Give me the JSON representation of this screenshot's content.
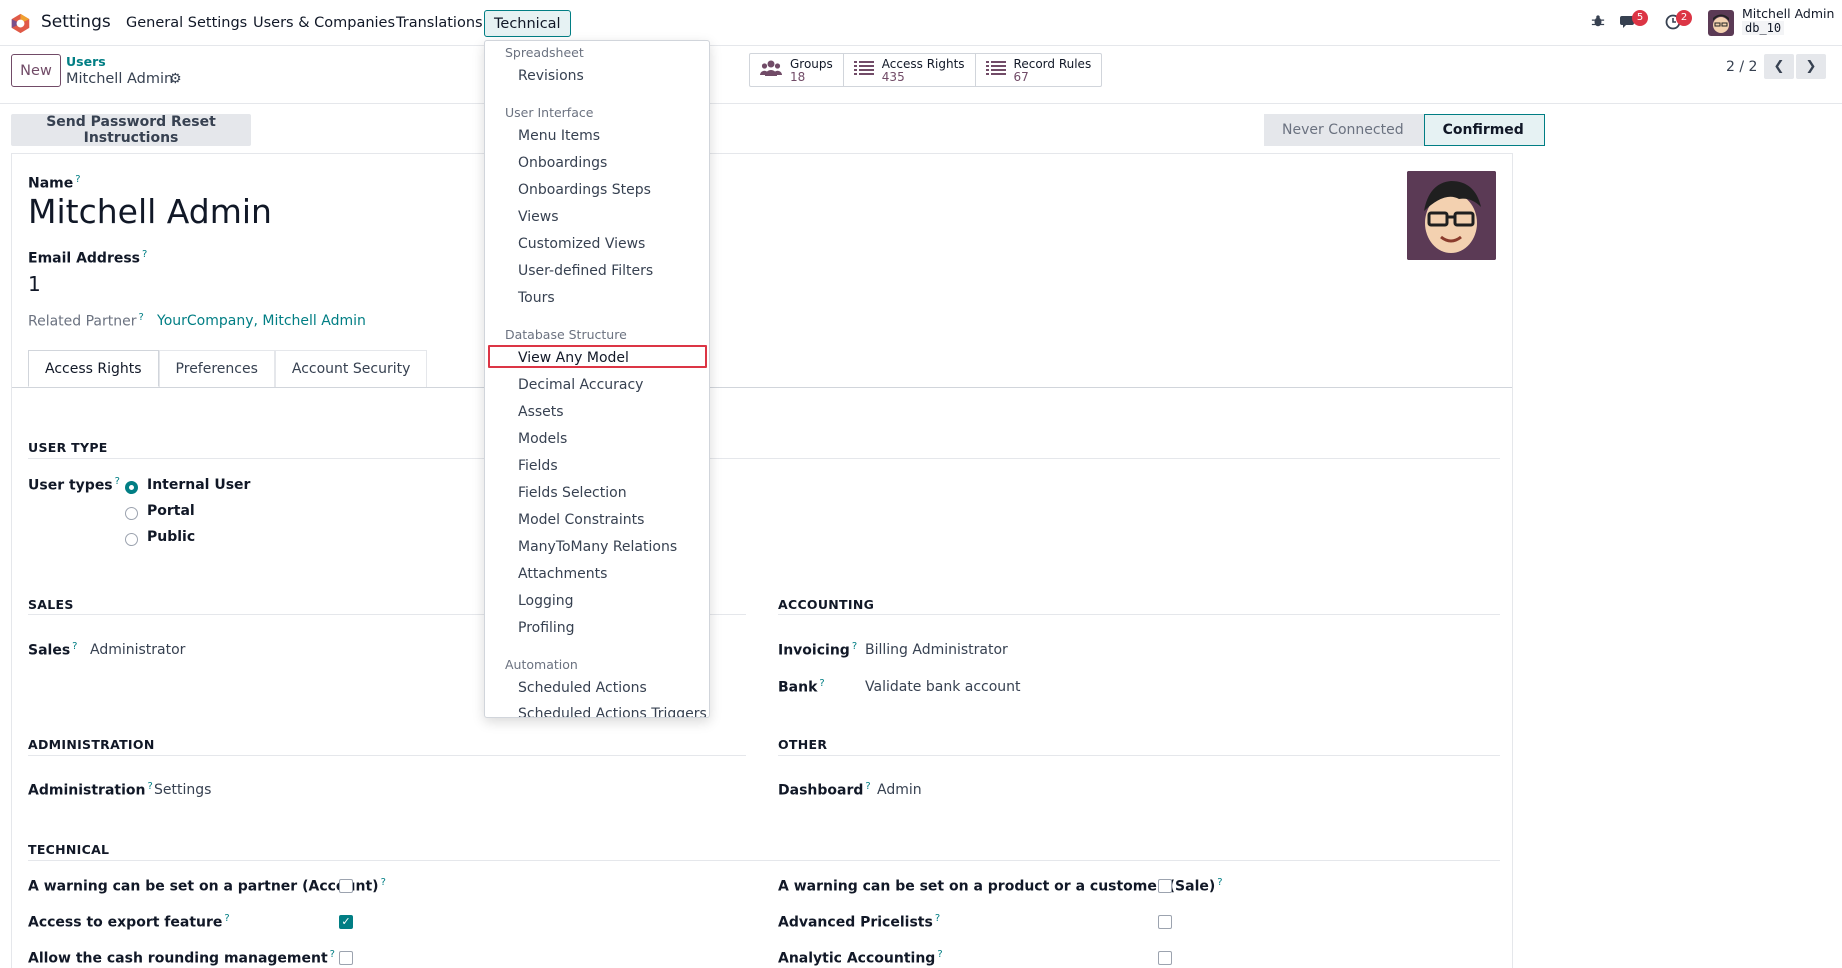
{
  "navbar": {
    "app_name": "Settings",
    "menus": [
      "General Settings",
      "Users & Companies",
      "Translations",
      "Technical"
    ],
    "chat_badge": "5",
    "activity_badge": "2",
    "user_name": "Mitchell Admin",
    "db_name": "db_10"
  },
  "control": {
    "new_label": "New",
    "breadcrumb_parent": "Users",
    "breadcrumb_current": "Mitchell Admin",
    "smart_buttons": [
      {
        "label": "Groups",
        "value": "18"
      },
      {
        "label": "Access Rights",
        "value": "435"
      },
      {
        "label": "Record Rules",
        "value": "67"
      }
    ],
    "pager": "2 / 2"
  },
  "status": {
    "reset_label": "Send Password Reset Instructions",
    "stages": [
      "Never Connected",
      "Confirmed"
    ]
  },
  "form": {
    "name_label": "Name",
    "name_value": "Mitchell Admin",
    "email_label": "Email Address",
    "email_value": "1",
    "partner_label": "Related Partner",
    "partner_value": "YourCompany, Mitchell Admin",
    "question": "?"
  },
  "tabs": [
    "Access Rights",
    "Preferences",
    "Account Security"
  ],
  "access": {
    "user_type_title": "USER TYPE",
    "user_types_label": "User types",
    "user_type_options": [
      "Internal User",
      "Portal",
      "Public"
    ],
    "sales_title": "SALES",
    "sales_label": "Sales",
    "sales_value": "Administrator",
    "accounting_title": "ACCOUNTING",
    "invoicing_label": "Invoicing",
    "invoicing_value": "Billing Administrator",
    "bank_label": "Bank",
    "bank_value": "Validate bank account",
    "administration_title": "ADMINISTRATION",
    "administration_label": "Administration",
    "administration_value": "Settings",
    "other_title": "OTHER",
    "dashboard_label": "Dashboard",
    "dashboard_value": "Admin",
    "technical_title": "TECHNICAL",
    "technical_left": [
      {
        "label": "A warning can be set on a partner (Account)",
        "checked": false
      },
      {
        "label": "Access to export feature",
        "checked": true
      },
      {
        "label": "Allow the cash rounding management",
        "checked": false
      }
    ],
    "technical_right": [
      {
        "label": "A warning can be set on a product or a customer (Sale)",
        "checked": false
      },
      {
        "label": "Advanced Pricelists",
        "checked": false
      },
      {
        "label": "Analytic Accounting",
        "checked": false
      }
    ]
  },
  "dropdown": {
    "sections": [
      {
        "header": "Spreadsheet",
        "items": [
          "Revisions"
        ]
      },
      {
        "header": "User Interface",
        "items": [
          "Menu Items",
          "Onboardings",
          "Onboardings Steps",
          "Views",
          "Customized Views",
          "User-defined Filters",
          "Tours"
        ]
      },
      {
        "header": "Database Structure",
        "items": [
          "View Any Model",
          "Decimal Accuracy",
          "Assets",
          "Models",
          "Fields",
          "Fields Selection",
          "Model Constraints",
          "ManyToMany Relations",
          "Attachments",
          "Logging",
          "Profiling"
        ]
      },
      {
        "header": "Automation",
        "items": [
          "Scheduled Actions",
          "Scheduled Actions Triggers"
        ]
      }
    ],
    "highlighted_item": "View Any Model"
  },
  "colors": {
    "brand": "#714b67",
    "accent": "#017e84",
    "badge": "#dc3545"
  }
}
